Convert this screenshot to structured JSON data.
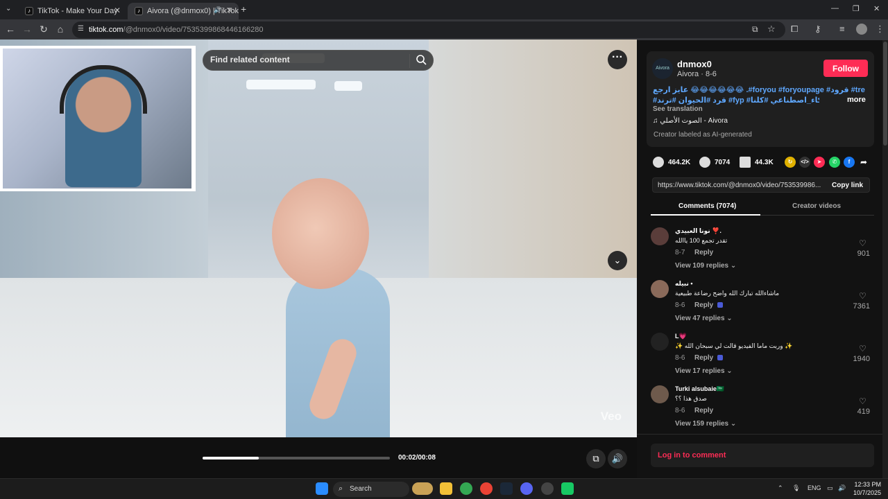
{
  "browser": {
    "tabs": [
      {
        "title": "TikTok - Make Your Day"
      },
      {
        "title": "Aivora (@dnmox0) | TikTok"
      }
    ],
    "address": {
      "host": "tiktok.com",
      "path": "/@dnmox0/video/7535399868446166280"
    }
  },
  "video": {
    "search_placeholder": "Find related content",
    "watermark": "Veo",
    "time": "00:02/00:08",
    "progress_fraction": 0.3
  },
  "author": {
    "username": "dnmox0",
    "subline": "Aivora · 8-6",
    "follow_label": "Follow",
    "avatar_text": "Aivora",
    "caption_line1": "عايز ارجع 😂😂😂😂😂😂 .#foryou #foryoupage #قرود #trend",
    "caption_line2": "#قرد #الحيوان #ترند #fyp #فلوق #ذكاء_اصطناعي #كلنا ...",
    "more_label": "more",
    "see_translation": "See translation",
    "music": "الصوت الأصلي - Aivora",
    "ai_label": "Creator labeled as AI-generated"
  },
  "stats": {
    "likes": "464.2K",
    "comments": "7074",
    "saves": "44.3K"
  },
  "link": {
    "url": "https://www.tiktok.com/@dnmox0/video/753539986...",
    "copy_label": "Copy link"
  },
  "tabs": {
    "comments": "Comments (7074)",
    "creator_videos": "Creator videos"
  },
  "comments": [
    {
      "name": "نونا العبيدي ❣️.",
      "text": "تقدر تجمع 100 ياالله",
      "date": "8-7",
      "reply": "Reply",
      "view": "View 109 replies ⌄",
      "likes": "901"
    },
    {
      "name": "نبيله •",
      "text": "ماشاءالله تبارك الله واضح رضاعة طبيعية",
      "date": "8-6",
      "reply": "Reply",
      "view": "View 47 replies ⌄",
      "likes": "7361"
    },
    {
      "name": "L💗",
      "text": "✨ وربت ماما الفيديو قالت لي سبحان الله ✨",
      "date": "8-6",
      "reply": "Reply",
      "view": "View 17 replies ⌄",
      "likes": "1940"
    },
    {
      "name": "Turki alsubaie🇸🇦",
      "text": "صدق هذا ؟؟",
      "date": "8-6",
      "reply": "Reply",
      "view": "View 159 replies ⌄",
      "likes": "419"
    }
  ],
  "login_label": "Log in to comment",
  "taskbar": {
    "search_label": "Search",
    "lang": "ENG",
    "time": "12:33 PM",
    "date": "10/7/2025"
  },
  "colors": {
    "accent": "#fe2c55",
    "link": "#5fa8ff"
  }
}
